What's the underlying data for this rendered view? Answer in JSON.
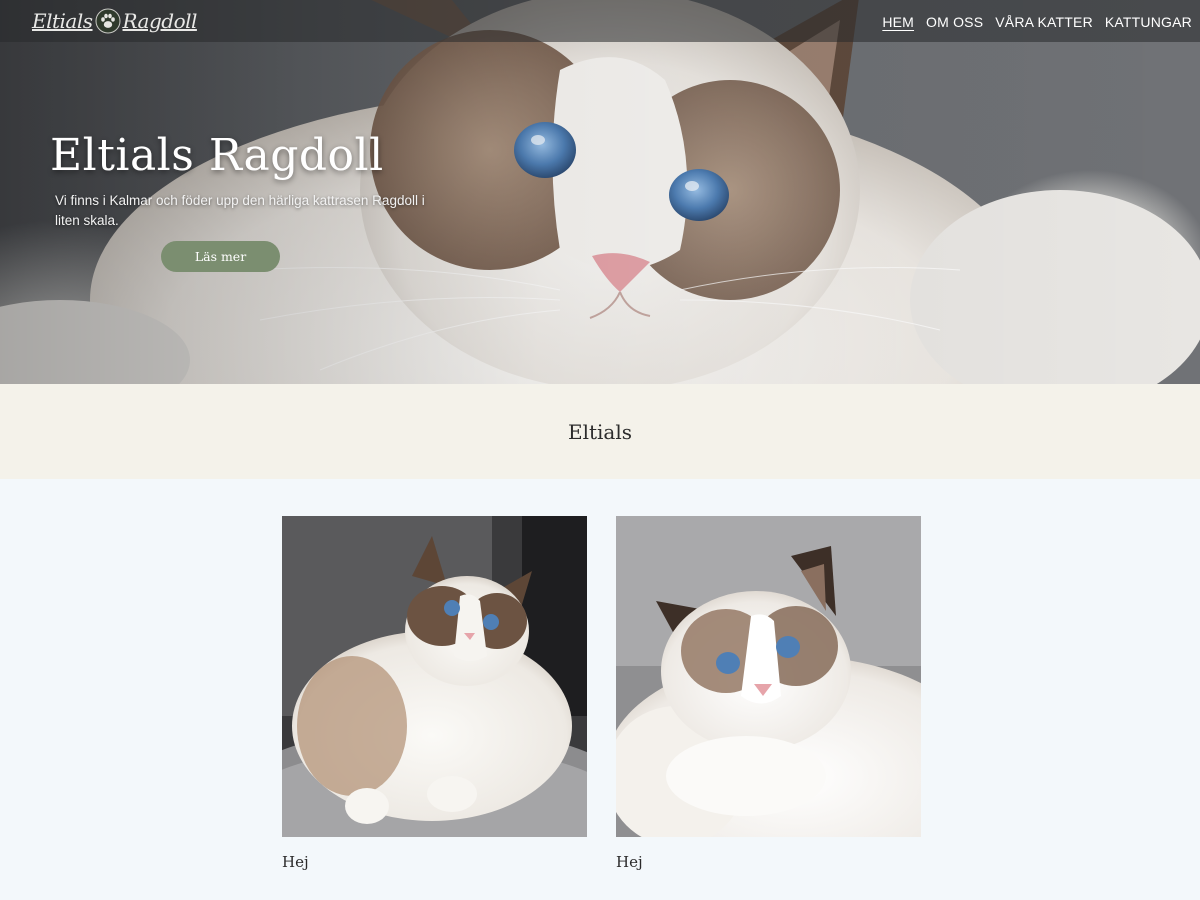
{
  "brand": {
    "logo_text_left": "Eltials",
    "logo_text_right": "Ragdoll"
  },
  "nav": {
    "items": [
      {
        "label": "HEM",
        "active": true
      },
      {
        "label": "OM OSS",
        "active": false
      },
      {
        "label": "VÅRA KATTER",
        "active": false
      },
      {
        "label": "KATTUNGAR",
        "active": false
      }
    ]
  },
  "hero": {
    "title": "Eltials Ragdoll",
    "text": "Vi finns i Kalmar och föder upp den härliga kattrasen Ragdoll i liten skala.",
    "button_label": "Läs mer"
  },
  "band": {
    "title": "Eltials"
  },
  "cards": [
    {
      "caption": "Hej"
    },
    {
      "caption": "Hej"
    }
  ],
  "colors": {
    "accent_button": "#7b8e70",
    "band_background": "#f4f2ea",
    "page_background": "#f3f8fb"
  }
}
